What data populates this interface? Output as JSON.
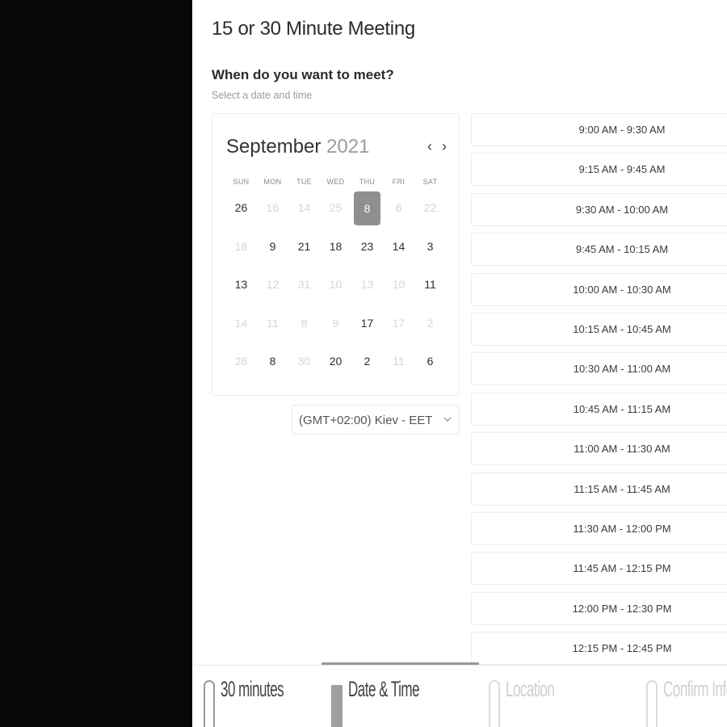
{
  "page": {
    "title": "15 or 30 Minute Meeting",
    "question": "When do you want to meet?",
    "subtitle": "Select a date and time"
  },
  "calendar": {
    "month": "September",
    "year": "2021",
    "prev_icon": "‹",
    "next_icon": "›",
    "weekdays": [
      "SUN",
      "MON",
      "TUE",
      "WED",
      "THU",
      "FRI",
      "SAT"
    ],
    "days": [
      {
        "label": "26",
        "state": "active"
      },
      {
        "label": "16",
        "state": "off"
      },
      {
        "label": "14",
        "state": "off"
      },
      {
        "label": "25",
        "state": "off"
      },
      {
        "label": "8",
        "state": "selected"
      },
      {
        "label": "6",
        "state": "off"
      },
      {
        "label": "22",
        "state": "off"
      },
      {
        "label": "18",
        "state": "off"
      },
      {
        "label": "9",
        "state": "active"
      },
      {
        "label": "21",
        "state": "active"
      },
      {
        "label": "18",
        "state": "active"
      },
      {
        "label": "23",
        "state": "active"
      },
      {
        "label": "14",
        "state": "active"
      },
      {
        "label": "3",
        "state": "active"
      },
      {
        "label": "13",
        "state": "active"
      },
      {
        "label": "12",
        "state": "off"
      },
      {
        "label": "31",
        "state": "off"
      },
      {
        "label": "10",
        "state": "off"
      },
      {
        "label": "13",
        "state": "off"
      },
      {
        "label": "10",
        "state": "off"
      },
      {
        "label": "11",
        "state": "active"
      },
      {
        "label": "14",
        "state": "off"
      },
      {
        "label": "11",
        "state": "off"
      },
      {
        "label": "8",
        "state": "off"
      },
      {
        "label": "9",
        "state": "off"
      },
      {
        "label": "17",
        "state": "active"
      },
      {
        "label": "17",
        "state": "off"
      },
      {
        "label": "2",
        "state": "off"
      },
      {
        "label": "26",
        "state": "off"
      },
      {
        "label": "8",
        "state": "active"
      },
      {
        "label": "30",
        "state": "off"
      },
      {
        "label": "20",
        "state": "active"
      },
      {
        "label": "2",
        "state": "active"
      },
      {
        "label": "11",
        "state": "off"
      },
      {
        "label": "6",
        "state": "active"
      }
    ],
    "selected_color": "#8f8f8f"
  },
  "timezone": {
    "value": "(GMT+02:00) Kiev - EET",
    "chevron_icon": "chevron-down-icon"
  },
  "time_slots": [
    "9:00 AM - 9:30 AM",
    "9:15 AM - 9:45 AM",
    "9:30 AM - 10:00 AM",
    "9:45 AM - 10:15 AM",
    "10:00 AM - 10:30 AM",
    "10:15 AM - 10:45 AM",
    "10:30 AM - 11:00 AM",
    "10:45 AM - 11:15 AM",
    "11:00 AM - 11:30 AM",
    "11:15 AM - 11:45 AM",
    "11:30 AM - 12:00 PM",
    "11:45 AM - 12:15 PM",
    "12:00 PM - 12:30 PM",
    "12:15 PM - 12:45 PM"
  ],
  "steps": [
    {
      "label": "30 minutes",
      "state": "done"
    },
    {
      "label": "Date & Time",
      "state": "active"
    },
    {
      "label": "Location",
      "state": "upcoming"
    },
    {
      "label": "Confirm Info",
      "state": "upcoming"
    }
  ],
  "colors": {
    "sidebar": "#070707",
    "panel": "#ffffff",
    "accent": "#8f8f8f"
  }
}
